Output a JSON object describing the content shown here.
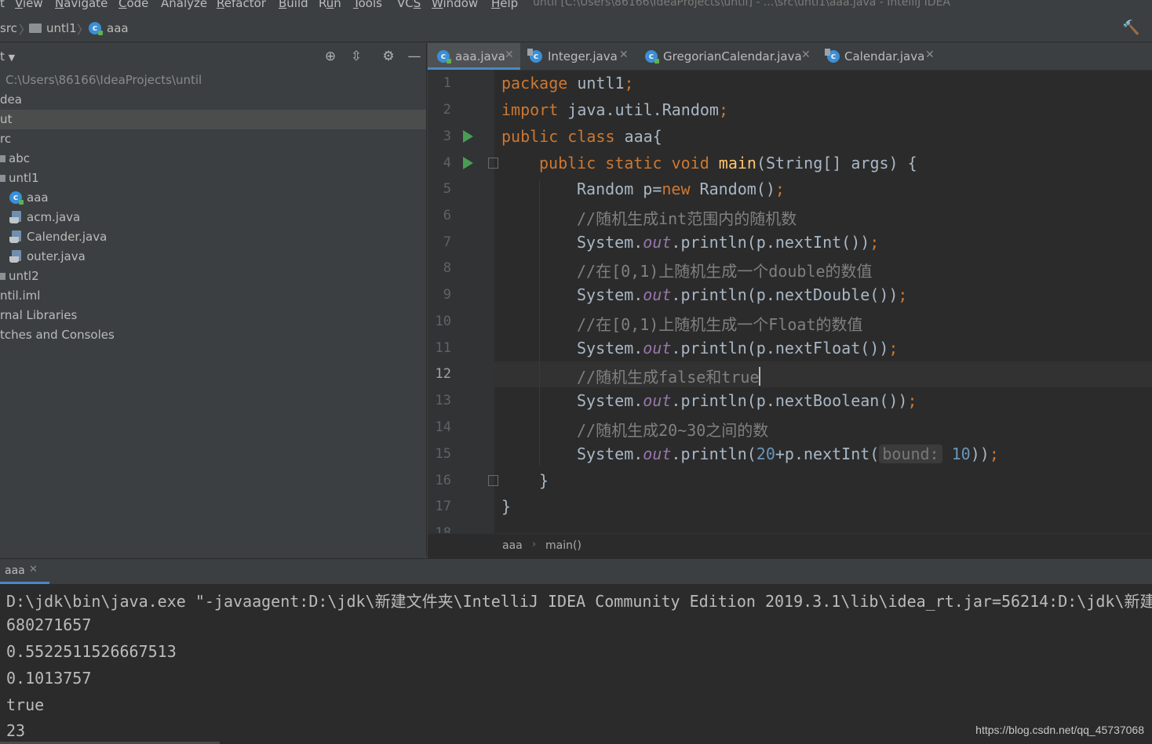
{
  "menubar": {
    "items": [
      {
        "label": "t"
      },
      {
        "label": "View",
        "mnemonic": "V"
      },
      {
        "label": "Navigate",
        "mnemonic": "N"
      },
      {
        "label": "Code",
        "mnemonic": "C"
      },
      {
        "label": "Analyze"
      },
      {
        "label": "Refactor",
        "mnemonic": "R"
      },
      {
        "label": "Build",
        "mnemonic": "B"
      },
      {
        "label": "Run",
        "mnemonic": "u"
      },
      {
        "label": "Tools",
        "mnemonic": "T"
      },
      {
        "label": "VCS",
        "mnemonic": "S"
      },
      {
        "label": "Window",
        "mnemonic": "W"
      },
      {
        "label": "Help",
        "mnemonic": "H"
      }
    ],
    "window_title": "until [C:\\Users\\86166\\IdeaProjects\\until] - ...\\src\\untl1\\aaa.java - IntelliJ IDEA"
  },
  "navbar": {
    "crumbs": [
      "src",
      "untl1",
      "aaa"
    ]
  },
  "project_panel": {
    "header_label": "t",
    "tree": [
      {
        "label": "C:\\Users\\86166\\IdeaProjects\\until",
        "kind": "path"
      },
      {
        "label": "dea",
        "kind": "folder"
      },
      {
        "label": "ut",
        "kind": "folder",
        "selected": true
      },
      {
        "label": "rc",
        "kind": "folder"
      },
      {
        "label": "abc",
        "kind": "package"
      },
      {
        "label": "untl1",
        "kind": "package"
      },
      {
        "label": "aaa",
        "kind": "class"
      },
      {
        "label": "acm.java",
        "kind": "java"
      },
      {
        "label": "Calender.java",
        "kind": "java"
      },
      {
        "label": "outer.java",
        "kind": "java"
      },
      {
        "label": "untl2",
        "kind": "package"
      },
      {
        "label": "ntil.iml",
        "kind": "file"
      },
      {
        "label": "rnal Libraries",
        "kind": "lib"
      },
      {
        "label": "tches and Consoles",
        "kind": "misc"
      }
    ]
  },
  "editor_tabs": [
    {
      "label": "aaa.java",
      "active": true,
      "icon": "class-icon"
    },
    {
      "label": "Integer.java",
      "active": false,
      "icon": "library-class-icon"
    },
    {
      "label": "GregorianCalendar.java",
      "active": false,
      "icon": "class-icon"
    },
    {
      "label": "Calendar.java",
      "active": false,
      "icon": "library-class-icon"
    }
  ],
  "editor": {
    "current_line": 12,
    "line_numbers": [
      "1",
      "2",
      "3",
      "4",
      "5",
      "6",
      "7",
      "8",
      "9",
      "10",
      "11",
      "12",
      "13",
      "14",
      "15",
      "16",
      "17",
      "18"
    ],
    "code": {
      "l1_kw": "package",
      "l1_rest": " untl1",
      "l1_semi": ";",
      "l2_kw": "import",
      "l2_rest": " java.util.Random",
      "l2_semi": ";",
      "l3_kw": "public class",
      "l3_rest": " aaa{",
      "l4_kw": "public static void",
      "l4_fn": "main",
      "l4_rest": "(String[] args) {",
      "l5_a": "Random p=",
      "l5_kw": "new",
      "l5_b": " Random()",
      "l5_semi": ";",
      "l6_cmt": "//随机生成int范围内的随机数",
      "l7_a": "System.",
      "l7_fld": "out",
      "l7_b": ".println(p.nextInt())",
      "l7_semi": ";",
      "l8_cmt": "//在[0,1)上随机生成一个double的数值",
      "l9_a": "System.",
      "l9_fld": "out",
      "l9_b": ".println(p.nextDouble())",
      "l9_semi": ";",
      "l10_cmt": "//在[0,1)上随机生成一个Float的数值",
      "l11_a": "System.",
      "l11_fld": "out",
      "l11_b": ".println(p.nextFloat())",
      "l11_semi": ";",
      "l12_cmt": "//随机生成false和true",
      "l13_a": "System.",
      "l13_fld": "out",
      "l13_b": ".println(p.nextBoolean())",
      "l13_semi": ";",
      "l14_cmt": "//随机生成20~30之间的数",
      "l15_a": "System.",
      "l15_fld": "out",
      "l15_b": ".println(",
      "l15_num1": "20",
      "l15_c": "+p.nextInt(",
      "l15_hint": "bound:",
      "l15_num2": "10",
      "l15_d": "))",
      "l15_semi": ";",
      "l16": "}",
      "l17": "}"
    }
  },
  "editor_breadcrumb": {
    "class": "aaa",
    "method": "main()"
  },
  "run_window": {
    "tab_label": "aaa",
    "output": [
      "D:\\jdk\\bin\\java.exe \"-javaagent:D:\\jdk\\新建文件夹\\IntelliJ IDEA Community Edition 2019.3.1\\lib\\idea_rt.jar=56214:D:\\jdk\\新建",
      "680271657",
      "0.5522511526667513",
      "0.1013757",
      "true",
      "23"
    ]
  },
  "watermark": "https://blog.csdn.net/qq_45737068",
  "colors": {
    "keyword": "#cc7832",
    "method": "#ffc66d",
    "static_field": "#9876aa",
    "comment": "#808080",
    "number": "#6897bb",
    "accent": "#4a88c7",
    "run_icon": "#499c54"
  }
}
